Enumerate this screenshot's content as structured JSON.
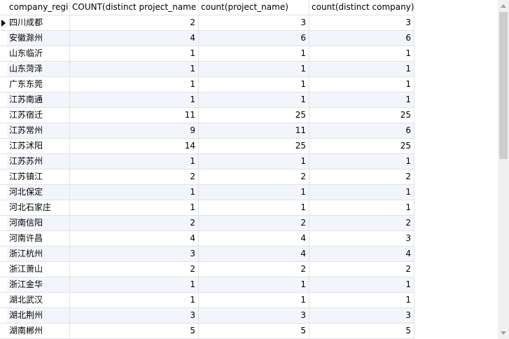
{
  "columns": [
    "company_regi",
    "COUNT(distinct project_name )",
    "count(project_name)",
    "count(distinct company)"
  ],
  "rows": [
    {
      "region": "四川成都",
      "distinct_project": "2",
      "project": "3",
      "distinct_company": "3"
    },
    {
      "region": "安徽滁州",
      "distinct_project": "4",
      "project": "6",
      "distinct_company": "6"
    },
    {
      "region": "山东临沂",
      "distinct_project": "1",
      "project": "1",
      "distinct_company": "1"
    },
    {
      "region": "山东菏泽",
      "distinct_project": "1",
      "project": "1",
      "distinct_company": "1"
    },
    {
      "region": "广东东莞",
      "distinct_project": "1",
      "project": "1",
      "distinct_company": "1"
    },
    {
      "region": "江苏南通",
      "distinct_project": "1",
      "project": "1",
      "distinct_company": "1"
    },
    {
      "region": "江苏宿迁",
      "distinct_project": "11",
      "project": "25",
      "distinct_company": "25"
    },
    {
      "region": "江苏常州",
      "distinct_project": "9",
      "project": "11",
      "distinct_company": "6"
    },
    {
      "region": "江苏沭阳",
      "distinct_project": "14",
      "project": "25",
      "distinct_company": "25"
    },
    {
      "region": "江苏苏州",
      "distinct_project": "1",
      "project": "1",
      "distinct_company": "1"
    },
    {
      "region": "江苏镇江",
      "distinct_project": "2",
      "project": "2",
      "distinct_company": "2"
    },
    {
      "region": "河北保定",
      "distinct_project": "1",
      "project": "1",
      "distinct_company": "1"
    },
    {
      "region": "河北石家庄",
      "distinct_project": "1",
      "project": "1",
      "distinct_company": "1"
    },
    {
      "region": "河南信阳",
      "distinct_project": "2",
      "project": "2",
      "distinct_company": "2"
    },
    {
      "region": "河南许昌",
      "distinct_project": "4",
      "project": "4",
      "distinct_company": "3"
    },
    {
      "region": "浙江杭州",
      "distinct_project": "3",
      "project": "4",
      "distinct_company": "4"
    },
    {
      "region": "浙江萧山",
      "distinct_project": "2",
      "project": "2",
      "distinct_company": "2"
    },
    {
      "region": "浙江金华",
      "distinct_project": "1",
      "project": "1",
      "distinct_company": "1"
    },
    {
      "region": "湖北武汉",
      "distinct_project": "1",
      "project": "1",
      "distinct_company": "1"
    },
    {
      "region": "湖北荆州",
      "distinct_project": "3",
      "project": "3",
      "distinct_company": "3"
    },
    {
      "region": "湖南郴州",
      "distinct_project": "5",
      "project": "5",
      "distinct_company": "5"
    }
  ],
  "colors": {
    "alt_row": "#f2f6fc",
    "gridline": "#e2e2e2",
    "scrollbar": "#f0f0f0",
    "thumb": "#cdcdcd"
  },
  "icons": {
    "current_row_marker": "triangle-right-icon"
  }
}
